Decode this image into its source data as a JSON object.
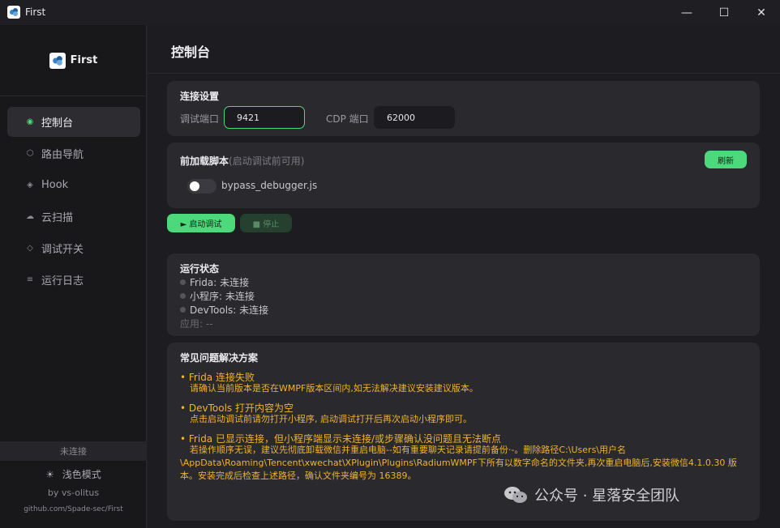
{
  "window": {
    "title": "First",
    "minimize": "—",
    "maximize": "☐",
    "close": "✕"
  },
  "sidebar": {
    "brand": "First",
    "items": [
      {
        "label": "控制台",
        "icon": "◉",
        "active": true
      },
      {
        "label": "路由导航",
        "icon": "⬡"
      },
      {
        "label": "Hook",
        "icon": "◈"
      },
      {
        "label": "云扫描",
        "icon": "☁"
      },
      {
        "label": "调试开关",
        "icon": "◇"
      },
      {
        "label": "运行日志",
        "icon": "≡"
      }
    ],
    "status": "未连接",
    "theme_icon": "☀",
    "theme": "浅色模式",
    "byline": "by vs-olitus",
    "github": "github.com/Spade-sec/First"
  },
  "page": {
    "title": "控制台"
  },
  "connection": {
    "title": "连接设置",
    "debug_port_label": "调试端口",
    "debug_port_value": "9421",
    "cdp_port_label": "CDP 端口",
    "cdp_port_value": "62000"
  },
  "preload": {
    "title": "前加载脚本",
    "hint": "(启动调试前可用)",
    "refresh": "刷新",
    "script_name": "bypass_debugger.js"
  },
  "actions": {
    "start": "► 启动调试",
    "stop": "■ 停止"
  },
  "run_status": {
    "title": "运行状态",
    "frida": "Frida: 未连接",
    "miniprogram": "小程序: 未连接",
    "devtools": "DevTools: 未连接",
    "app": "应用: --"
  },
  "faq": {
    "title": "常见问题解决方案",
    "items": [
      {
        "q": "• Frida 连接失败",
        "a": "请确认当前版本是否在WMPF版本区间内,如无法解决建议安装建议版本。"
      },
      {
        "q": "• DevTools 打开内容为空",
        "a": "点击启动调试前请勿打开小程序, 启动调试打开后再次启动小程序即可。"
      },
      {
        "q": "• Frida 已显示连接，但小程序端显示未连接/或步骤确认没问题且无法断点",
        "a": "若操作顺序无误，建议先彻底卸载微信并重启电脑--如有重要聊天记录请提前备份·-。删除路径C:\\Users\\用户名\\AppData\\Roaming\\Tencent\\xwechat\\XPlugin\\Plugins\\RadiumWMPF下所有以数字命名的文件夹,再次重启电脑后,安装微信4.1.0.30 版本。安装完成后检查上述路径，确认文件夹编号为 16389。"
      }
    ]
  },
  "watermark": {
    "text": "公众号 · 星落安全团队"
  },
  "colors": {
    "accent": "#4cd97b",
    "warning": "#f0b429"
  }
}
